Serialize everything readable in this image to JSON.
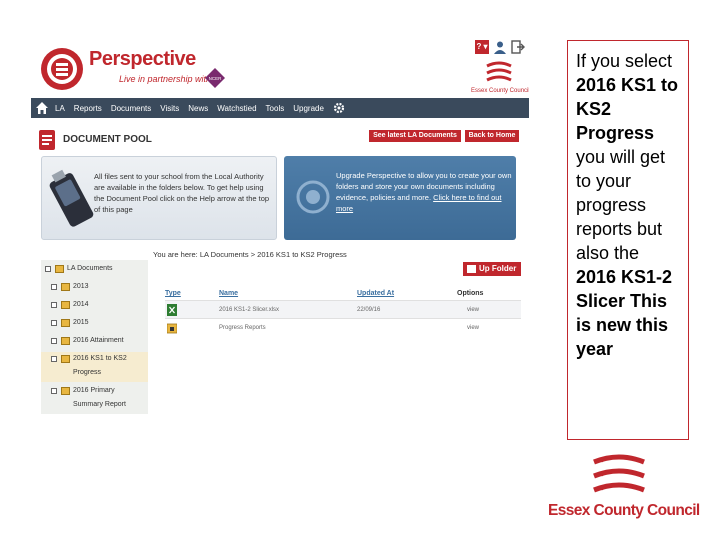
{
  "app": {
    "brand_title": "Perspective",
    "brand_tagline": "Live in partnership with",
    "badge_text": "NCER",
    "council_small": "Essex County Council",
    "help_label": "? ▾",
    "accent_color": "#c0272d",
    "nav_color": "#3a4a5c"
  },
  "nav": {
    "items": [
      "LA",
      "Reports",
      "Documents",
      "Visits",
      "News",
      "Watchstied",
      "Tools",
      "Upgrade"
    ]
  },
  "docpool": {
    "title": "DOCUMENT POOL",
    "see_latest_label": "See latest LA Documents",
    "back_home_label": "Back to Home"
  },
  "promo_left": {
    "text": "All files sent to your school from the Local Authority are available in the folders below. To get help using the Document Pool click on the Help arrow at the top of this page"
  },
  "promo_right": {
    "text": "Upgrade Perspective to allow you to create your own folders and store your own documents including evidence, policies and more. ",
    "link": "Click here to find out more"
  },
  "breadcrumb": "You are here: LA Documents > 2016 KS1 to KS2 Progress",
  "tree": {
    "root": "LA Documents",
    "items": [
      {
        "label": "2013"
      },
      {
        "label": "2014"
      },
      {
        "label": "2015"
      },
      {
        "label": "2016 Attainment"
      },
      {
        "label": "2016 KS1 to KS2",
        "sub": "Progress"
      },
      {
        "label": "2016 Primary",
        "sub": "Summary Report"
      }
    ]
  },
  "upfolder_label": "Up Folder",
  "table": {
    "headers": {
      "type": "Type",
      "name": "Name",
      "updated": "Updated At",
      "options": "Options"
    },
    "rows": [
      {
        "name": "2016 KS1-2 Slicer.xlsx",
        "updated": "22/09/16",
        "option": "view"
      },
      {
        "name": "Progress Reports",
        "updated": "",
        "option": "view"
      }
    ]
  },
  "caption": {
    "line1": "If you select ",
    "bold1": "2016 KS1 to KS2 Progress",
    "line2": " you will get to your progress reports but also the ",
    "bold2": "2016 KS1-2 Slicer This is new this year"
  },
  "footer_logo": {
    "text": "Essex County Council"
  }
}
